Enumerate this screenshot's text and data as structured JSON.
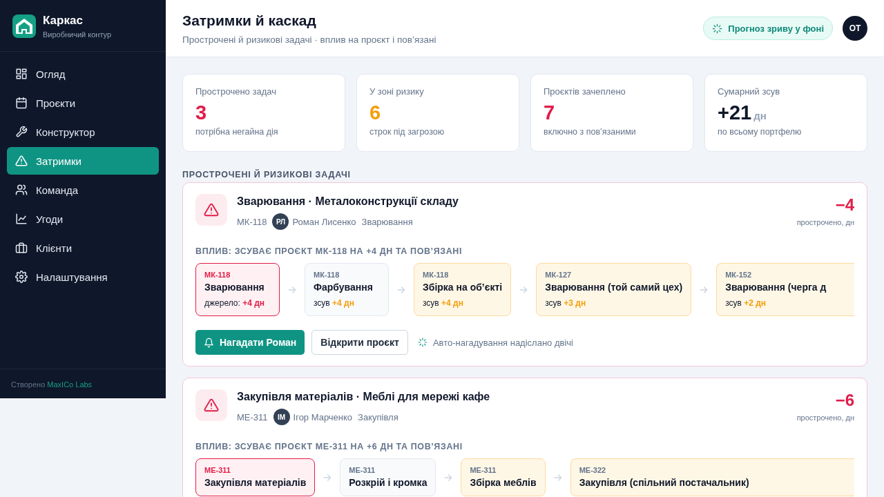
{
  "brand": {
    "name": "Каркас",
    "subtitle": "Виробничий контур"
  },
  "nav": [
    {
      "label": "Огляд",
      "selected": false
    },
    {
      "label": "Проєкти",
      "selected": false
    },
    {
      "label": "Конструктор",
      "selected": false
    },
    {
      "label": "Затримки",
      "selected": true
    },
    {
      "label": "Команда",
      "selected": false
    },
    {
      "label": "Угоди",
      "selected": false
    },
    {
      "label": "Клієнти",
      "selected": false
    },
    {
      "label": "Налаштування",
      "selected": false
    }
  ],
  "footer": {
    "prefix": "Створено",
    "link": "MaxICo Labs"
  },
  "header": {
    "title": "Затримки й каскад",
    "subtitle": "Прострочені й ризикові задачі · вплив на проєкт і пов’язані",
    "badge": "Прогноз зриву у фоні",
    "avatar": "ОТ"
  },
  "stats": [
    {
      "label": "Прострочено задач",
      "value": "3",
      "color": "#e11d48",
      "note": "потрібна негайна дія"
    },
    {
      "label": "У зоні ризику",
      "value": "6",
      "color": "#f59e0b",
      "note": "строк під загрозою"
    },
    {
      "label": "Проєктів зачеплено",
      "value": "7",
      "color": "#e11d48",
      "note": "включно з пов’язаними"
    },
    {
      "label": "Сумарний зсув",
      "value": "+21",
      "unit": "дн",
      "color": "#0f172a",
      "note": "по всьому портфелю"
    }
  ],
  "section_title": "ПРОСТРОЧЕНІ Й РИЗИКОВІ ЗАДАЧІ",
  "tasks": [
    {
      "title": "Зварювання · Металоконструкції складу",
      "code": "МК-118",
      "assignee": {
        "initials": "РЛ",
        "name": "Роман Лисенко"
      },
      "category": "Зварювання",
      "delay": "−4",
      "delay_label": "прострочено, дн",
      "impact": "ВПЛИВ: ЗСУВАЄ ПРОЄКТ МК-118 НА +4 ДН ТА ПОВ’ЯЗАНІ",
      "chain": [
        {
          "kind": "source",
          "code": "МК-118",
          "title": "Зварювання",
          "note": "джерело:",
          "shift": "+4 дн"
        },
        {
          "kind": "step",
          "code": "МК-118",
          "title": "Фарбування",
          "note": "зсув",
          "shift": "+4 дн"
        },
        {
          "kind": "related",
          "code": "МК-118",
          "title": "Збірка на об’єкті",
          "note": "зсув",
          "shift": "+4 дн"
        },
        {
          "kind": "related",
          "code": "МК-127",
          "title": "Зварювання (той самий цех)",
          "note": "зсув",
          "shift": "+3 дн"
        },
        {
          "kind": "related",
          "code": "МК-152",
          "title": "Зварювання (черга д",
          "note": "зсув",
          "shift": "+2 дн"
        }
      ],
      "actions": [
        {
          "kind": "primary",
          "label": "Нагадати Роман"
        },
        {
          "kind": "secondary",
          "label": "Відкрити проєкт"
        }
      ],
      "auto_note": "Авто-нагадування надіслано двічі"
    },
    {
      "title": "Закупівля матеріалів · Меблі для мережі кафе",
      "code": "МЕ-311",
      "assignee": {
        "initials": "IM",
        "name": "Ігор Марченко"
      },
      "category": "Закупівля",
      "delay": "−6",
      "delay_label": "прострочено, дн",
      "impact": "ВПЛИВ: ЗСУВАЄ ПРОЄКТ МЕ-311 НА +6 ДН ТА ПОВ’ЯЗАНІ",
      "chain": [
        {
          "kind": "source",
          "code": "МЕ-311",
          "title": "Закупівля матеріалів"
        },
        {
          "kind": "step",
          "code": "МЕ-311",
          "title": "Розкрій і кромка"
        },
        {
          "kind": "related",
          "code": "МЕ-311",
          "title": "Збірка меблів"
        },
        {
          "kind": "related",
          "code": "МЕ-322",
          "title": "Закупівля (спільний постачальник)"
        }
      ]
    }
  ]
}
